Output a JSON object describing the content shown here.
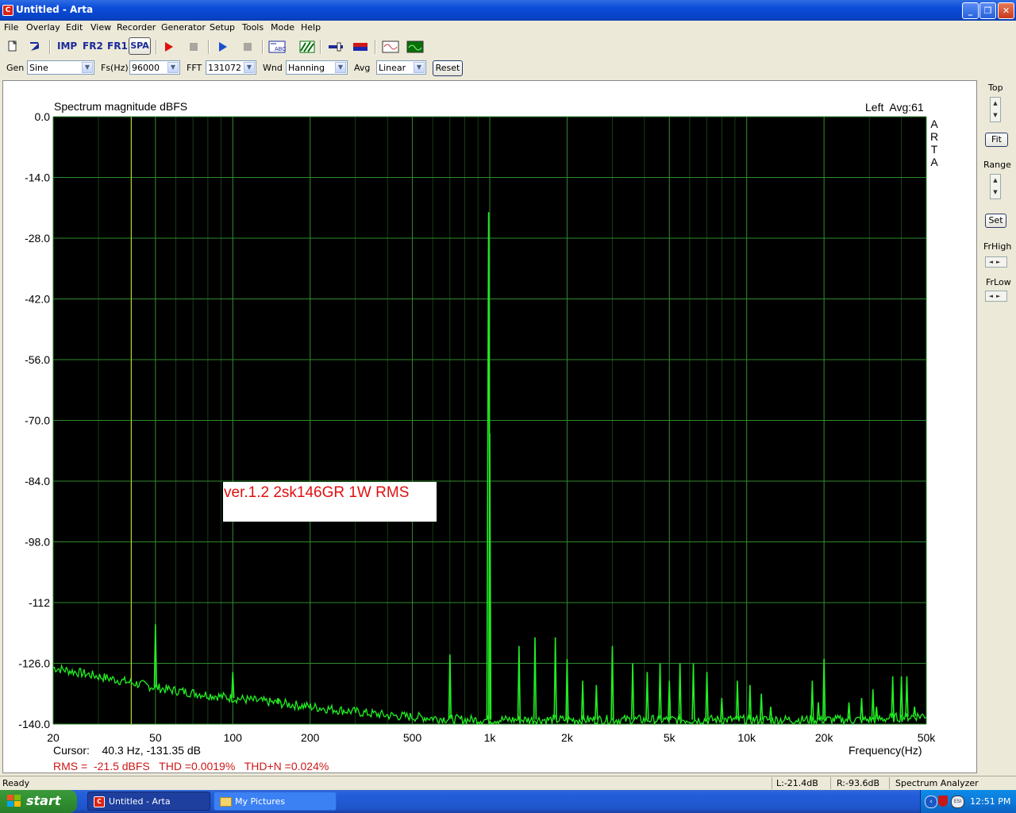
{
  "window": {
    "title": "Untitled - Arta"
  },
  "menu": [
    "File",
    "Overlay",
    "Edit",
    "View",
    "Recorder",
    "Generator",
    "Setup",
    "Tools",
    "Mode",
    "Help"
  ],
  "toolbar": {
    "imp": "IMP",
    "fr2": "FR2",
    "fr1": "FR1",
    "spa": "SPA"
  },
  "controls": {
    "gen_label": "Gen",
    "gen_value": "Sine",
    "fs_label": "Fs(Hz)",
    "fs_value": "96000",
    "fft_label": "FFT",
    "fft_value": "131072",
    "wnd_label": "Wnd",
    "wnd_value": "Hanning",
    "avg_label": "Avg",
    "avg_value": "Linear",
    "reset": "Reset"
  },
  "side": {
    "top": "Top",
    "fit": "Fit",
    "range": "Range",
    "set": "Set",
    "frhigh": "FrHigh",
    "frlow": "FrLow"
  },
  "plot": {
    "title": "Spectrum magnitude dBFS",
    "channel": "Left  Avg:61",
    "brand": [
      "A",
      "R",
      "T",
      "A"
    ],
    "annotation": "ver.1.2 2sk146GR 1W RMS",
    "cursor": "Cursor:    40.3 Hz, -131.35 dB",
    "stats": "RMS =  -21.5 dBFS   THD =0.0019%   THD+N =0.024%",
    "xlabel": "Frequency(Hz)"
  },
  "chart_data": {
    "type": "line",
    "title": "Spectrum magnitude dBFS",
    "xlabel": "Frequency(Hz)",
    "ylabel": "",
    "xscale": "log",
    "xlim": [
      20,
      50000
    ],
    "ylim": [
      -140,
      0
    ],
    "grid": true,
    "yticks": [
      "0.0",
      "-14.0",
      "-28.0",
      "-42.0",
      "-56.0",
      "-70.0",
      "-84.0",
      "-98.0",
      "-112",
      "-126.0",
      "-140.0"
    ],
    "ytick_values": [
      0,
      -14,
      -28,
      -42,
      -56,
      -70,
      -84,
      -98,
      -112,
      -126,
      -140
    ],
    "xticks": [
      "20",
      "50",
      "100",
      "200",
      "500",
      "1k",
      "2k",
      "5k",
      "10k",
      "20k",
      "50k"
    ],
    "xtick_values": [
      20,
      50,
      100,
      200,
      500,
      1000,
      2000,
      5000,
      10000,
      20000,
      50000
    ],
    "cursor_freq": 40.3,
    "noise_floor": [
      [
        20,
        -127
      ],
      [
        30,
        -129
      ],
      [
        45,
        -131
      ],
      [
        55,
        -132
      ],
      [
        100,
        -134
      ],
      [
        200,
        -136
      ],
      [
        400,
        -138
      ],
      [
        800,
        -139
      ],
      [
        2000,
        -139
      ],
      [
        10000,
        -139
      ],
      [
        30000,
        -139
      ],
      [
        50000,
        -138
      ]
    ],
    "peaks": [
      [
        50,
        -117
      ],
      [
        100,
        -128
      ],
      [
        150,
        -134
      ],
      [
        700,
        -124
      ],
      [
        990,
        -22
      ],
      [
        1000,
        -73
      ],
      [
        1300,
        -122
      ],
      [
        1500,
        -120
      ],
      [
        1800,
        -120
      ],
      [
        2000,
        -125
      ],
      [
        2300,
        -130
      ],
      [
        2600,
        -131
      ],
      [
        3000,
        -122
      ],
      [
        3600,
        -126
      ],
      [
        4100,
        -128
      ],
      [
        4600,
        -126
      ],
      [
        5000,
        -130
      ],
      [
        5500,
        -126
      ],
      [
        6200,
        -126
      ],
      [
        7000,
        -128
      ],
      [
        8000,
        -134
      ],
      [
        9200,
        -130
      ],
      [
        10300,
        -131
      ],
      [
        11400,
        -133
      ],
      [
        12400,
        -136
      ],
      [
        18000,
        -130
      ],
      [
        19000,
        -135
      ],
      [
        20000,
        -125
      ],
      [
        25000,
        -135
      ],
      [
        28000,
        -134
      ],
      [
        31000,
        -132
      ],
      [
        32000,
        -136
      ],
      [
        37000,
        -129
      ],
      [
        40000,
        -129
      ],
      [
        42000,
        -129
      ],
      [
        45000,
        -136
      ]
    ]
  },
  "status": {
    "ready": "Ready",
    "l": "L:-21.4dB",
    "r": "R:-93.6dB",
    "mode": "Spectrum Analyzer"
  },
  "taskbar": {
    "start": "start",
    "task1": "Untitled - Arta",
    "task2": "My Pictures",
    "clock": "12:51 PM"
  }
}
